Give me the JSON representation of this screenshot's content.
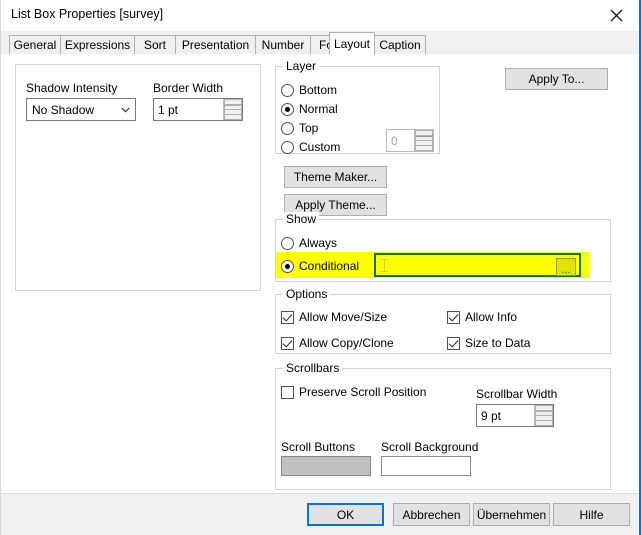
{
  "window": {
    "title": "List Box Properties [survey]",
    "close_icon": "close-icon"
  },
  "tabs": [
    {
      "label": "General",
      "selected": false
    },
    {
      "label": "Expressions",
      "selected": false
    },
    {
      "label": "Sort",
      "selected": false
    },
    {
      "label": "Presentation",
      "selected": false
    },
    {
      "label": "Number",
      "selected": false
    },
    {
      "label": "Font",
      "selected": false
    },
    {
      "label": "Layout",
      "selected": true
    },
    {
      "label": "Caption",
      "selected": false
    }
  ],
  "appearance": {
    "shadow_intensity": {
      "label": "Shadow Intensity",
      "value": "No Shadow",
      "icon": "chevron-down-icon"
    },
    "border_width": {
      "label": "Border Width",
      "value": "1 pt"
    }
  },
  "layer": {
    "title": "Layer",
    "options": [
      {
        "label": "Bottom",
        "selected": false
      },
      {
        "label": "Normal",
        "selected": true
      },
      {
        "label": "Top",
        "selected": false
      },
      {
        "label": "Custom",
        "selected": false
      }
    ],
    "custom_value": "0",
    "custom_enabled": false
  },
  "theme": {
    "maker_label": "Theme Maker...",
    "apply_label": "Apply Theme..."
  },
  "apply_to": {
    "label": "Apply To..."
  },
  "show": {
    "title": "Show",
    "options": [
      {
        "label": "Always",
        "selected": false
      },
      {
        "label": "Conditional",
        "selected": true
      }
    ],
    "conditional_value": "",
    "conditional_ellipsis": "...",
    "highlight_color": "#ffff00",
    "focus_border_color": "#136b36"
  },
  "options": {
    "title": "Options",
    "items": [
      {
        "label": "Allow Move/Size",
        "checked": true
      },
      {
        "label": "Allow Info",
        "checked": true
      },
      {
        "label": "Allow Copy/Clone",
        "checked": true
      },
      {
        "label": "Size to Data",
        "checked": true
      }
    ]
  },
  "scrollbars": {
    "title": "Scrollbars",
    "preserve_scroll_position": {
      "label": "Preserve Scroll Position",
      "checked": false
    },
    "scrollbar_width": {
      "label": "Scrollbar Width",
      "value": "9 pt"
    },
    "scroll_buttons": {
      "label": "Scroll Buttons",
      "color": "#c0c0c0"
    },
    "scroll_background": {
      "label": "Scroll Background",
      "color": "#ffffff"
    }
  },
  "buttonbar": {
    "ok": "OK",
    "cancel": "Abbrechen",
    "apply": "Übernehmen",
    "help": "Hilfe"
  }
}
